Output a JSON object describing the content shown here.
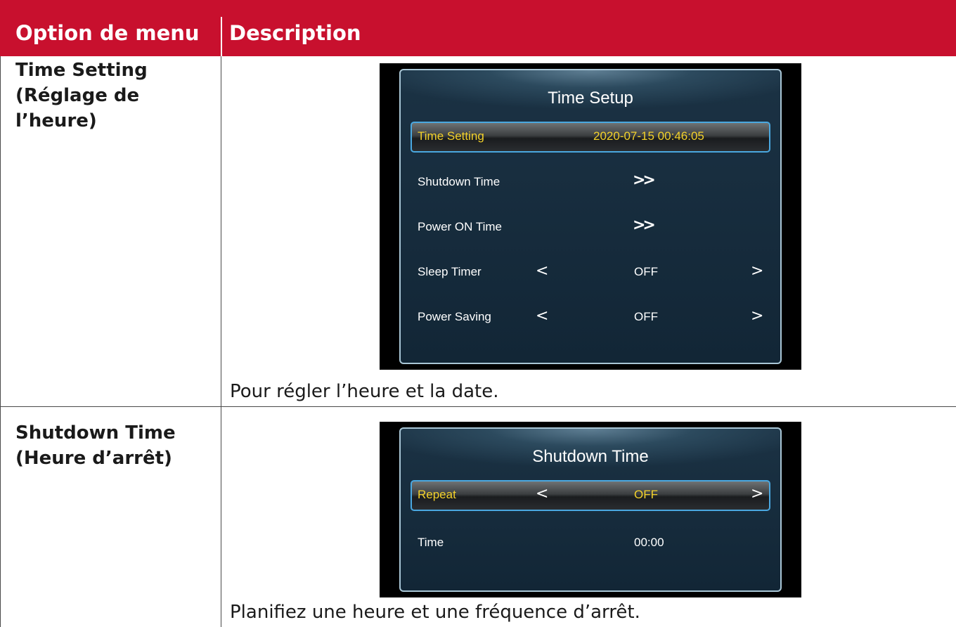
{
  "table": {
    "headers": {
      "option": "Option de menu",
      "description": "Description"
    },
    "rows": [
      {
        "label_lines": [
          "Time Setting",
          "(Réglage de",
          "l’heure)"
        ],
        "description": "Pour régler l’heure et la date.",
        "osd": {
          "title": "Time Setup",
          "items": [
            {
              "label": "Time Setting",
              "value": "2020-07-15 00:46:05",
              "selected": true
            },
            {
              "label": "Shutdown Time",
              "value": "»"
            },
            {
              "label": "Power ON Time",
              "value": "»"
            },
            {
              "label": "Sleep Timer",
              "left_arrow": "<",
              "value": "OFF",
              "right_arrow": ">"
            },
            {
              "label": "Power Saving",
              "left_arrow": "<",
              "value": "OFF",
              "right_arrow": ">"
            }
          ]
        }
      },
      {
        "label_lines": [
          "Shutdown Time",
          "(Heure d’arrêt)"
        ],
        "description": "Planifiez une heure et une fréquence d’arrêt.",
        "osd": {
          "title": "Shutdown Time",
          "items": [
            {
              "label": "Repeat",
              "left_arrow": "<",
              "value": "OFF",
              "right_arrow": ">",
              "selected": true
            },
            {
              "label": "Time",
              "value": "00:00"
            }
          ]
        }
      }
    ]
  },
  "colors": {
    "header_bg": "#c8102e",
    "selected_text": "#f3d12a",
    "highlight_border": "#4aa8e0"
  }
}
